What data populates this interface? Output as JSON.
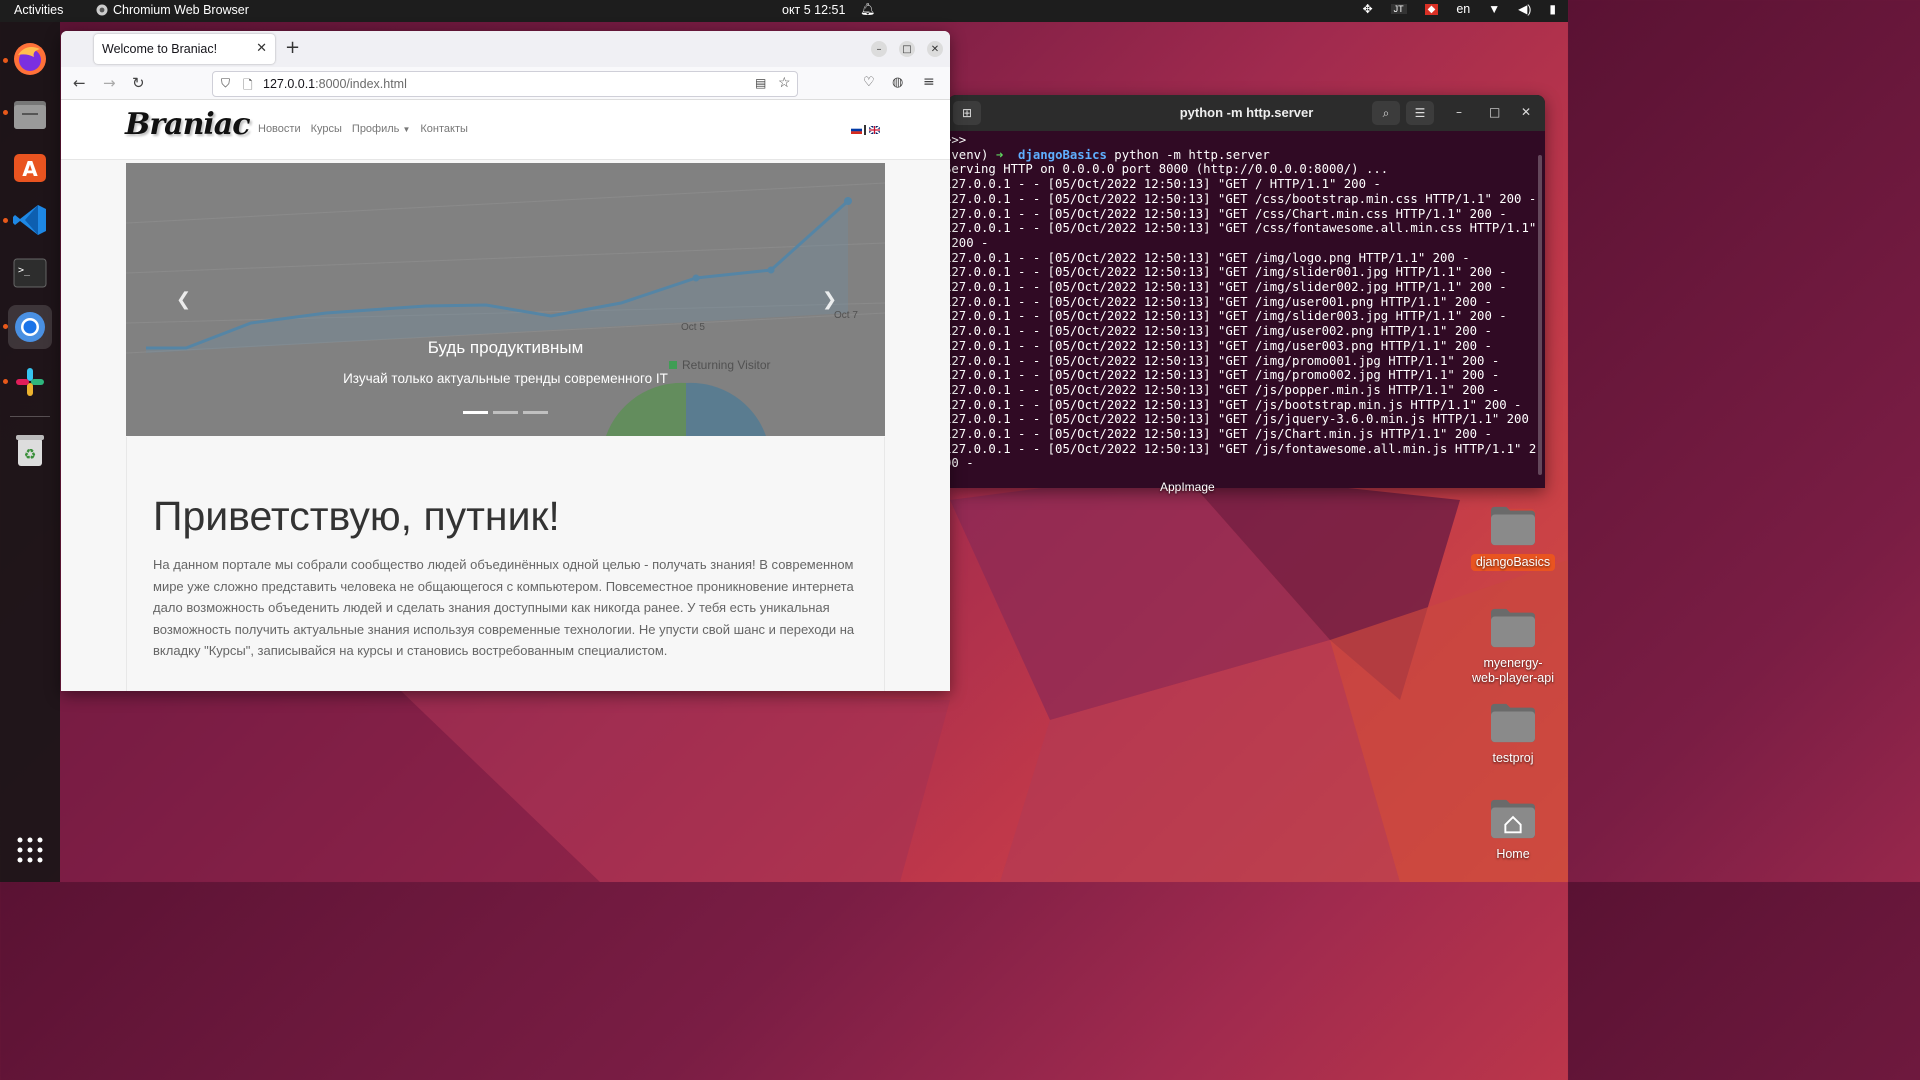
{
  "topbar": {
    "activities": "Activities",
    "app_name": "Chromium Web Browser",
    "clock": "окт 5  12:51",
    "language": "en"
  },
  "dock": {
    "items": [
      "firefox",
      "files",
      "app-center",
      "vscode",
      "terminal",
      "chromium",
      "slack",
      "trash",
      "show-apps"
    ]
  },
  "browser": {
    "tab_title": "Welcome to Braniac!",
    "url_host": "127.0.0.1",
    "url_rest": ":8000/index.html"
  },
  "site": {
    "logo": "Braniac",
    "menu": [
      "Новости",
      "Курсы",
      "Профиль",
      "Контакты"
    ],
    "carousel": {
      "title": "Будь продуктивным",
      "subtitle": "Изучай только актуальные тренды современного IT",
      "slides": 3,
      "active_slide": 1,
      "bg_chart_labels": [
        "Oct 5",
        "Oct 7",
        "Returning Visitor"
      ]
    },
    "heading": "Приветствую, путник!",
    "paragraph": "На данном портале мы собрали сообщество людей объединённых одной целью - получать знания! В современном мире уже сложно представить человека не общающегося с компьютером. Повсеместное проникновение интернета дало возможность объеденить людей и сделать знания доступными как никогда ранее. У тебя есть уникальная возможность получить актуальные знания используя современные технологии. Не упусти свой шанс и переходи на вкладку \"Курсы\", записывайся на курсы и становись востребованным специалистом."
  },
  "terminal": {
    "title": "python -m http.server",
    "prompt_env": "(venv)",
    "prompt_dir": "djangoBasics",
    "command": "python -m http.server",
    "lines": [
      ">>>",
      "Serving HTTP on 0.0.0.0 port 8000 (http://0.0.0.0:8000/) ...",
      "127.0.0.1 - - [05/Oct/2022 12:50:13] \"GET / HTTP/1.1\" 200 -",
      "127.0.0.1 - - [05/Oct/2022 12:50:13] \"GET /css/bootstrap.min.css HTTP/1.1\" 200 -",
      "127.0.0.1 - - [05/Oct/2022 12:50:13] \"GET /css/Chart.min.css HTTP/1.1\" 200 -",
      "127.0.0.1 - - [05/Oct/2022 12:50:13] \"GET /css/fontawesome.all.min.css HTTP/1.1\"",
      " 200 -",
      "127.0.0.1 - - [05/Oct/2022 12:50:13] \"GET /img/logo.png HTTP/1.1\" 200 -",
      "127.0.0.1 - - [05/Oct/2022 12:50:13] \"GET /img/slider001.jpg HTTP/1.1\" 200 -",
      "127.0.0.1 - - [05/Oct/2022 12:50:13] \"GET /img/slider002.jpg HTTP/1.1\" 200 -",
      "127.0.0.1 - - [05/Oct/2022 12:50:13] \"GET /img/user001.png HTTP/1.1\" 200 -",
      "127.0.0.1 - - [05/Oct/2022 12:50:13] \"GET /img/slider003.jpg HTTP/1.1\" 200 -",
      "127.0.0.1 - - [05/Oct/2022 12:50:13] \"GET /img/user002.png HTTP/1.1\" 200 -",
      "127.0.0.1 - - [05/Oct/2022 12:50:13] \"GET /img/user003.png HTTP/1.1\" 200 -",
      "127.0.0.1 - - [05/Oct/2022 12:50:13] \"GET /img/promo001.jpg HTTP/1.1\" 200 -",
      "127.0.0.1 - - [05/Oct/2022 12:50:13] \"GET /img/promo002.jpg HTTP/1.1\" 200 -",
      "127.0.0.1 - - [05/Oct/2022 12:50:13] \"GET /js/popper.min.js HTTP/1.1\" 200 -",
      "127.0.0.1 - - [05/Oct/2022 12:50:13] \"GET /js/bootstrap.min.js HTTP/1.1\" 200 -",
      "127.0.0.1 - - [05/Oct/2022 12:50:13] \"GET /js/jquery-3.6.0.min.js HTTP/1.1\" 200",
      "",
      "127.0.0.1 - - [05/Oct/2022 12:50:13] \"GET /js/Chart.min.js HTTP/1.1\" 200 -",
      "127.0.0.1 - - [05/Oct/2022 12:50:13] \"GET /js/fontawesome.all.min.js HTTP/1.1\" 2",
      "00 -"
    ]
  },
  "desktop": {
    "appimage_label": "AppImage",
    "icons": [
      "djangoBasics",
      "myenergy-web-player-api",
      "testproj",
      "Home"
    ],
    "selected": "djangoBasics"
  },
  "colors": {
    "ubuntu_orange": "#e95420",
    "terminal_bg": "#300a24",
    "chart_line": "#4a8ab5"
  }
}
